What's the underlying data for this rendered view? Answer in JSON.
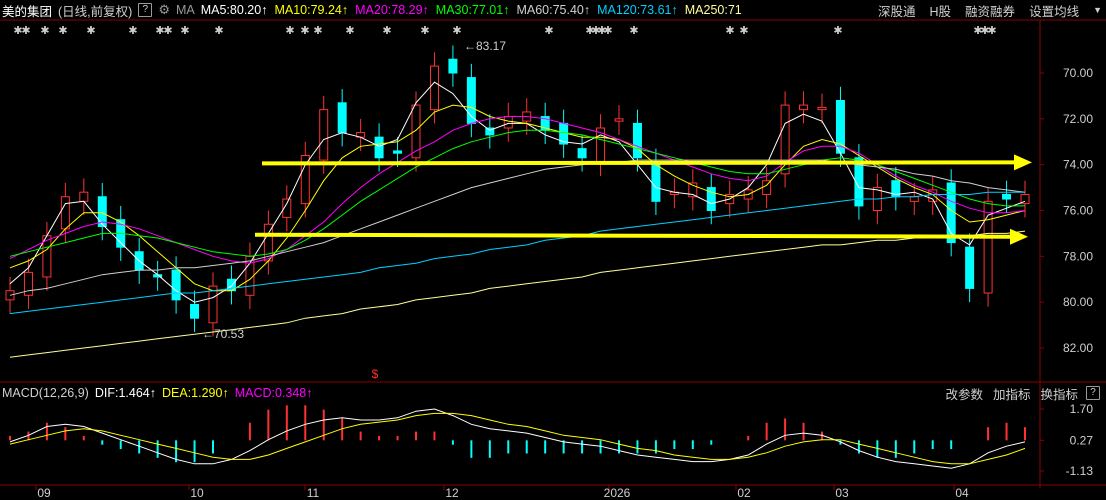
{
  "header": {
    "stock_name": "美的集团",
    "period": "(日线,前复权)",
    "help_icon": "?",
    "settings_icon": "gear-icon",
    "ma_label": "MA",
    "ma": [
      {
        "label": "MA5:80.20",
        "arrow": "↑",
        "color": "#ffffff"
      },
      {
        "label": "MA10:79.24",
        "arrow": "↑",
        "color": "#ffff00"
      },
      {
        "label": "MA20:78.29",
        "arrow": "↑",
        "color": "#ff00ff"
      },
      {
        "label": "MA30:77.01",
        "arrow": "↑",
        "color": "#00ff00"
      },
      {
        "label": "MA60:75.40",
        "arrow": "↑",
        "color": "#cfcfcf"
      },
      {
        "label": "MA120:73.61",
        "arrow": "↑",
        "color": "#00d0ff"
      },
      {
        "label": "MA250:71",
        "arrow": "",
        "color": "#ffff99"
      }
    ],
    "right_buttons": [
      "深股通",
      "H股",
      "融资融券",
      "设置均线"
    ],
    "dropdown_icon": "▼"
  },
  "price_axis": {
    "ticks": [
      "82.00",
      "80.00",
      "78.00",
      "76.00",
      "74.00",
      "72.00",
      "70.00"
    ]
  },
  "annotations": {
    "high": "83.17",
    "low": "70.53",
    "marker": "$"
  },
  "event_marks": "✱",
  "macd": {
    "title": "MACD(12,26,9)",
    "dif": "DIF:1.464",
    "dif_arrow": "↑",
    "dea": "DEA:1.290",
    "dea_arrow": "↑",
    "macd": "MACD:0.348",
    "macd_arrow": "↑",
    "tools": [
      "改参数",
      "加指标",
      "换指标"
    ],
    "help_icon": "?",
    "axis": [
      "1.70",
      "0.27",
      "-1.13"
    ]
  },
  "time_axis": {
    "labels": [
      "09",
      "10",
      "11",
      "12",
      "2026",
      "01",
      "02",
      "03",
      "04"
    ]
  },
  "colors": {
    "up": "#ff3232",
    "down": "#00ffff",
    "trendline": "#ffff00"
  },
  "chart_data": {
    "type": "line",
    "title": "美的集团 (日线,前复权)",
    "ylim": [
      69.0,
      84.0
    ],
    "yticks": [
      70,
      72,
      74,
      76,
      78,
      80,
      82
    ],
    "x_labels": [
      "09",
      "10",
      "11",
      "12",
      "2026",
      "01",
      "02",
      "03",
      "04"
    ],
    "series": [
      {
        "name": "close",
        "values": [
          72.5,
          73.3,
          74.9,
          76.6,
          76.8,
          75.3,
          74.4,
          73.4,
          73.1,
          72.1,
          71.3,
          72.7,
          72.5,
          74.0,
          75.4,
          76.5,
          78.4,
          80.4,
          79.4,
          79.4,
          78.3,
          78.5,
          80.6,
          82.3,
          82.0,
          79.8,
          79.3,
          80.1,
          80.3,
          79.5,
          78.9,
          78.3,
          79.6,
          80.0,
          78.3,
          76.4,
          76.8,
          77.2,
          76.0,
          76.7,
          76.9,
          77.3,
          80.6,
          80.6,
          80.5,
          78.5,
          76.2,
          77.0,
          76.6,
          76.6,
          76.9,
          74.6,
          72.6,
          76.4,
          76.5,
          76.7
        ]
      },
      {
        "name": "MA5",
        "values": [
          72.8,
          73.5,
          74.9,
          76.3,
          76.4,
          75.4,
          74.6,
          73.8,
          73.2,
          72.5,
          72.0,
          72.2,
          72.7,
          73.7,
          75.0,
          76.3,
          78.0,
          79.1,
          79.4,
          79.2,
          78.8,
          79.1,
          80.7,
          81.6,
          81.1,
          80.1,
          79.5,
          79.8,
          79.8,
          79.3,
          79.0,
          78.9,
          79.3,
          79.0,
          78.0,
          77.0,
          76.8,
          76.7,
          76.3,
          76.5,
          77.0,
          78.0,
          79.8,
          80.2,
          79.9,
          78.5,
          77.0,
          76.9,
          76.7,
          76.8,
          76.5,
          75.0,
          74.5,
          75.8,
          76.1,
          76.4
        ]
      },
      {
        "name": "MA10",
        "values": [
          73.5,
          73.8,
          74.3,
          75.2,
          75.9,
          75.9,
          75.5,
          74.9,
          74.2,
          73.5,
          72.8,
          72.5,
          72.5,
          73.0,
          73.8,
          74.8,
          76.0,
          77.3,
          78.3,
          78.8,
          78.9,
          79.0,
          79.5,
          80.3,
          80.6,
          80.5,
          80.1,
          79.9,
          79.8,
          79.6,
          79.4,
          79.2,
          79.2,
          79.1,
          78.7,
          78.0,
          77.5,
          77.1,
          76.8,
          76.6,
          76.7,
          77.1,
          78.0,
          78.8,
          79.1,
          78.9,
          78.4,
          77.9,
          77.4,
          77.0,
          76.7,
          76.0,
          75.5,
          75.6,
          75.8,
          76.0
        ]
      },
      {
        "name": "MA20",
        "values": [
          73.9,
          74.3,
          74.7,
          75.0,
          75.3,
          75.5,
          75.4,
          75.2,
          74.9,
          74.6,
          74.3,
          74.0,
          73.8,
          73.7,
          73.9,
          74.3,
          74.9,
          75.5,
          76.3,
          77.0,
          77.6,
          78.1,
          78.6,
          79.0,
          79.5,
          79.8,
          80.0,
          80.1,
          80.1,
          80.0,
          79.8,
          79.6,
          79.4,
          79.1,
          78.8,
          78.5,
          78.2,
          77.9,
          77.6,
          77.4,
          77.3,
          77.5,
          78.1,
          78.6,
          78.8,
          78.8,
          78.5,
          78.0,
          77.5,
          77.1,
          76.8,
          76.4,
          76.1,
          75.9,
          75.9,
          76.0
        ]
      },
      {
        "name": "MA30",
        "values": [
          74.0,
          74.2,
          74.4,
          74.6,
          74.8,
          75.0,
          75.0,
          74.9,
          74.8,
          74.6,
          74.4,
          74.2,
          74.1,
          74.0,
          74.1,
          74.3,
          74.7,
          75.2,
          75.8,
          76.4,
          76.9,
          77.4,
          77.9,
          78.3,
          78.7,
          79.0,
          79.2,
          79.4,
          79.5,
          79.5,
          79.4,
          79.3,
          79.1,
          78.9,
          78.7,
          78.5,
          78.3,
          78.1,
          77.9,
          77.7,
          77.6,
          77.6,
          77.8,
          78.0,
          78.2,
          78.3,
          78.2,
          78.0,
          77.7,
          77.4,
          77.1,
          76.8,
          76.5,
          76.3,
          76.2,
          76.2
        ]
      },
      {
        "name": "MA60",
        "values": [
          72.3,
          72.5,
          72.6,
          72.8,
          73.0,
          73.2,
          73.3,
          73.4,
          73.4,
          73.5,
          73.5,
          73.6,
          73.7,
          73.8,
          74.0,
          74.2,
          74.4,
          74.6,
          74.9,
          75.2,
          75.5,
          75.8,
          76.1,
          76.4,
          76.7,
          77.0,
          77.2,
          77.4,
          77.6,
          77.8,
          77.9,
          78.0,
          78.1,
          78.1,
          78.2,
          78.2,
          78.2,
          78.2,
          78.2,
          78.2,
          78.2,
          78.2,
          78.2,
          78.2,
          78.2,
          78.1,
          78.0,
          77.9,
          77.8,
          77.6,
          77.5,
          77.3,
          77.2,
          77.0,
          76.9,
          76.8
        ]
      },
      {
        "name": "MA120",
        "values": [
          71.5,
          71.6,
          71.7,
          71.8,
          71.9,
          72.0,
          72.1,
          72.2,
          72.3,
          72.4,
          72.4,
          72.5,
          72.6,
          72.7,
          72.8,
          72.9,
          73.0,
          73.1,
          73.2,
          73.3,
          73.5,
          73.6,
          73.7,
          73.9,
          74.0,
          74.1,
          74.3,
          74.4,
          74.5,
          74.7,
          74.8,
          74.9,
          75.1,
          75.2,
          75.3,
          75.4,
          75.5,
          75.6,
          75.7,
          75.8,
          75.9,
          76.0,
          76.1,
          76.2,
          76.3,
          76.4,
          76.5,
          76.5,
          76.6,
          76.6,
          76.7,
          76.7,
          76.7,
          76.8,
          76.8,
          76.8
        ]
      },
      {
        "name": "MA250",
        "values": [
          69.6,
          69.7,
          69.8,
          69.9,
          70.0,
          70.1,
          70.2,
          70.3,
          70.4,
          70.5,
          70.6,
          70.7,
          70.8,
          70.9,
          71.0,
          71.1,
          71.3,
          71.4,
          71.5,
          71.7,
          71.8,
          71.9,
          72.1,
          72.2,
          72.3,
          72.4,
          72.6,
          72.7,
          72.8,
          72.9,
          73.0,
          73.1,
          73.3,
          73.4,
          73.5,
          73.6,
          73.7,
          73.8,
          73.9,
          74.0,
          74.1,
          74.2,
          74.3,
          74.4,
          74.5,
          74.5,
          74.6,
          74.7,
          74.7,
          74.8,
          74.8,
          74.9,
          74.9,
          75.0,
          75.0,
          75.1
        ]
      }
    ],
    "macd": {
      "ylim": [
        -1.5,
        2.0
      ],
      "yticks": [
        1.7,
        0.27,
        -1.13
      ],
      "dif": [
        0.2,
        0.5,
        0.9,
        1.0,
        0.9,
        0.6,
        0.3,
        0.0,
        -0.3,
        -0.6,
        -0.8,
        -0.8,
        -0.6,
        -0.2,
        0.3,
        0.7,
        1.0,
        1.2,
        1.3,
        1.2,
        1.2,
        1.3,
        1.6,
        1.7,
        1.4,
        1.0,
        0.8,
        0.7,
        0.6,
        0.4,
        0.2,
        0.1,
        0.0,
        -0.2,
        -0.4,
        -0.5,
        -0.6,
        -0.7,
        -0.7,
        -0.6,
        -0.4,
        0.1,
        0.5,
        0.6,
        0.5,
        0.2,
        -0.2,
        -0.5,
        -0.7,
        -0.8,
        -0.9,
        -1.0,
        -0.8,
        -0.3,
        0.0,
        0.2
      ],
      "dea": [
        0.1,
        0.3,
        0.5,
        0.7,
        0.8,
        0.7,
        0.5,
        0.3,
        0.1,
        -0.1,
        -0.3,
        -0.5,
        -0.6,
        -0.6,
        -0.4,
        -0.1,
        0.2,
        0.5,
        0.8,
        1.0,
        1.1,
        1.2,
        1.4,
        1.5,
        1.5,
        1.4,
        1.2,
        1.0,
        0.9,
        0.7,
        0.5,
        0.4,
        0.3,
        0.1,
        -0.1,
        -0.2,
        -0.4,
        -0.5,
        -0.6,
        -0.6,
        -0.5,
        -0.3,
        0.0,
        0.2,
        0.3,
        0.3,
        0.1,
        -0.1,
        -0.3,
        -0.5,
        -0.7,
        -0.8,
        -0.8,
        -0.6,
        -0.4,
        -0.1
      ]
    },
    "trendlines": [
      {
        "name": "upper",
        "y": 78.1
      },
      {
        "name": "lower",
        "y": 74.9
      }
    ],
    "xlabel": "",
    "ylabel": ""
  }
}
